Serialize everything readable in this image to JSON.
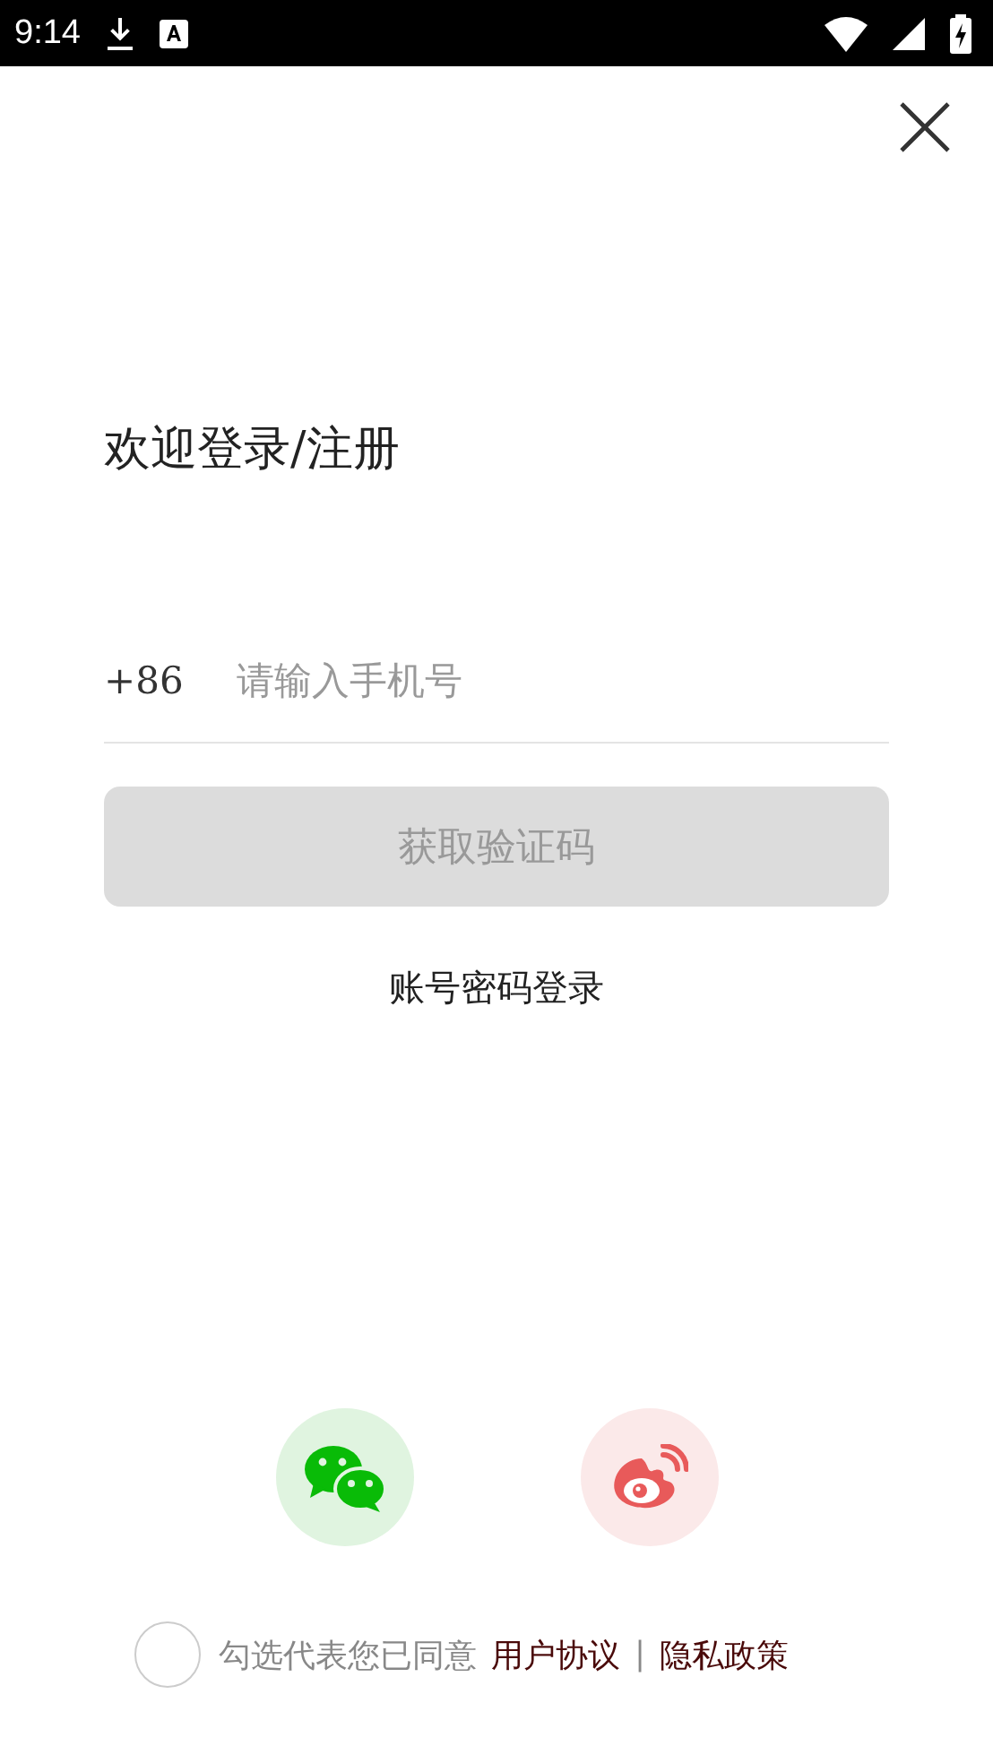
{
  "status_bar": {
    "time": "9:14"
  },
  "title": "欢迎登录/注册",
  "phone": {
    "prefix": "+86",
    "placeholder": "请输入手机号"
  },
  "code_button": {
    "label": "获取验证码",
    "disabled": true
  },
  "password_login": "账号密码登录",
  "social_logins": [
    {
      "kind": "wechat"
    },
    {
      "kind": "weibo"
    }
  ],
  "agreement": {
    "checked": false,
    "text": "勾选代表您已同意",
    "links": [
      "用户协议",
      "隐私政策"
    ],
    "separator": "|"
  }
}
